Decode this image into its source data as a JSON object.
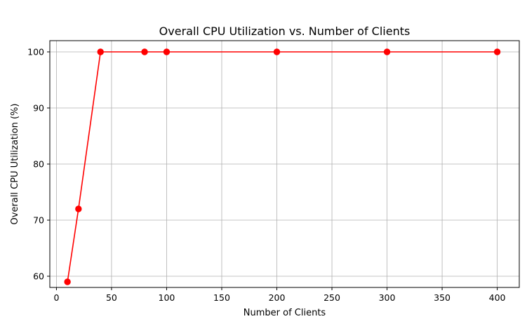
{
  "chart_data": {
    "type": "line",
    "title": "Overall CPU Utilization vs. Number of Clients",
    "xlabel": "Number of Clients",
    "ylabel": "Overall CPU Utilization (%)",
    "xlim": [
      -6,
      420
    ],
    "ylim": [
      58,
      102
    ],
    "xticks": [
      0,
      50,
      100,
      150,
      200,
      250,
      300,
      350,
      400
    ],
    "yticks": [
      60,
      70,
      80,
      90,
      100
    ],
    "grid": true,
    "series": [
      {
        "x": [
          10,
          20,
          40,
          80,
          100,
          200,
          300,
          400
        ],
        "y": [
          59,
          72,
          100,
          100,
          100,
          100,
          100,
          100
        ],
        "color": "#ff0000",
        "marker": "circle"
      }
    ]
  }
}
